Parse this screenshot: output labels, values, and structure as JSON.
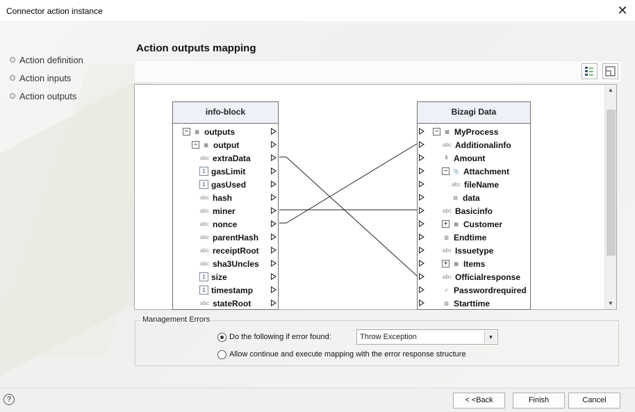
{
  "window": {
    "title": "Connector action instance",
    "close_glyph": "✕"
  },
  "nav": {
    "items": [
      "Action definition",
      "Action inputs",
      "Action outputs"
    ]
  },
  "section_title": "Action outputs mapping",
  "left_box": {
    "title": "info-block",
    "rows": [
      {
        "label": "outputs",
        "type": "table",
        "expander": "⊟"
      },
      {
        "label": "output",
        "type": "table",
        "expander": "⊟"
      },
      {
        "label": "extraData",
        "type": "abc"
      },
      {
        "label": "gasLimit",
        "type": "num"
      },
      {
        "label": "gasUsed",
        "type": "num"
      },
      {
        "label": "hash",
        "type": "abc"
      },
      {
        "label": "miner",
        "type": "abc"
      },
      {
        "label": "nonce",
        "type": "abc"
      },
      {
        "label": "parentHash",
        "type": "abc"
      },
      {
        "label": "receiptRoot",
        "type": "abc"
      },
      {
        "label": "sha3Uncles",
        "type": "abc"
      },
      {
        "label": "size",
        "type": "num"
      },
      {
        "label": "timestamp",
        "type": "num"
      },
      {
        "label": "stateRoot",
        "type": "abc"
      }
    ]
  },
  "right_box": {
    "title": "Bizagi Data",
    "rows": [
      {
        "label": "MyProcess",
        "type": "table",
        "expander": "⊟"
      },
      {
        "label": "Additionalinfo",
        "type": "abc"
      },
      {
        "label": "Amount",
        "type": "money"
      },
      {
        "label": "Attachment",
        "type": "attach",
        "expander": "⊟"
      },
      {
        "label": "fileName",
        "type": "abc"
      },
      {
        "label": "data",
        "type": "file"
      },
      {
        "label": "Basicinfo",
        "type": "abc"
      },
      {
        "label": "Customer",
        "type": "table",
        "expander": "⊞"
      },
      {
        "label": "Endtime",
        "type": "date"
      },
      {
        "label": "Issuetype",
        "type": "abc"
      },
      {
        "label": "Items",
        "type": "table",
        "expander": "⊞"
      },
      {
        "label": "Officialresponse",
        "type": "abc"
      },
      {
        "label": "Passwordrequired",
        "type": "check"
      },
      {
        "label": "Starttime",
        "type": "date"
      }
    ]
  },
  "mappings": [
    {
      "from": "extraData",
      "to": "Officialresponse"
    },
    {
      "from": "miner",
      "to": "Basicinfo"
    },
    {
      "from": "nonce",
      "to": "Additionalinfo"
    }
  ],
  "icons": {
    "abc": "abc",
    "num": "1",
    "table": "▦",
    "money": "$",
    "attach": "📎",
    "file": "▤",
    "date": "▥",
    "check": "✓",
    "scroll_up": "▲",
    "scroll_down": "▼",
    "select_arrow": "▾",
    "help": "?"
  },
  "errors": {
    "legend": "Management Errors",
    "option1": "Do the following if error found:",
    "option2": "Allow continue and execute mapping with the error response structure",
    "selected_option": 1,
    "select_value": "Throw Exception"
  },
  "buttons": {
    "back": "< <Back",
    "finish": "Finish",
    "cancel": "Cancel"
  }
}
